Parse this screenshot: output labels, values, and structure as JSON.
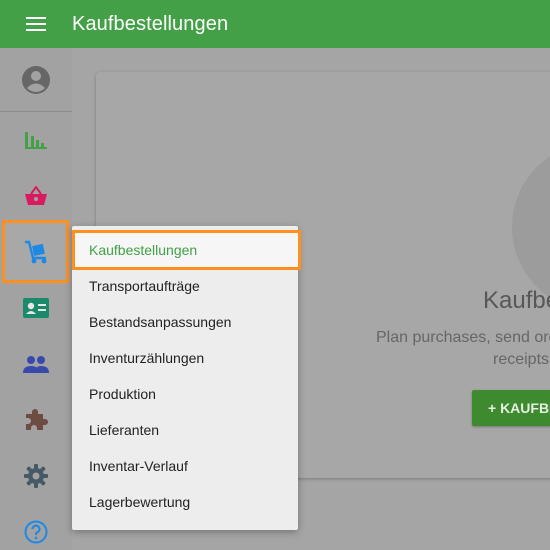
{
  "header": {
    "title": "Kaufbestellungen",
    "menu_icon": "hamburger-menu-icon",
    "color": "#43a047"
  },
  "sidebar": {
    "items": [
      {
        "icon": "account-circle-icon",
        "color": "#666666"
      },
      {
        "icon": "bar-chart-icon",
        "color": "#43a047"
      },
      {
        "icon": "shopping-basket-icon",
        "color": "#d81b60"
      },
      {
        "icon": "purchase-dolly-icon",
        "color": "#1e88e5",
        "active": true
      },
      {
        "icon": "contact-card-icon",
        "color": "#1b8a6b"
      },
      {
        "icon": "people-icon",
        "color": "#3949ab"
      },
      {
        "icon": "puzzle-icon",
        "color": "#6d4c41"
      },
      {
        "icon": "gear-icon",
        "color": "#455a64"
      },
      {
        "icon": "help-circle-icon",
        "color": "#1e88e5"
      }
    ]
  },
  "dropdown": {
    "items": [
      {
        "label": "Kaufbestellungen",
        "active": true
      },
      {
        "label": "Transportaufträge"
      },
      {
        "label": "Bestandsanpassungen"
      },
      {
        "label": "Inventurzählungen"
      },
      {
        "label": "Produktion"
      },
      {
        "label": "Lieferanten"
      },
      {
        "label": "Inventar-Verlauf"
      },
      {
        "label": "Lagerbewertung"
      }
    ]
  },
  "card": {
    "heading": "Kaufbe",
    "text_line1": "Plan purchases, send ord",
    "text_line2": "receipts",
    "button_label": "+ KAUFBESTE"
  }
}
